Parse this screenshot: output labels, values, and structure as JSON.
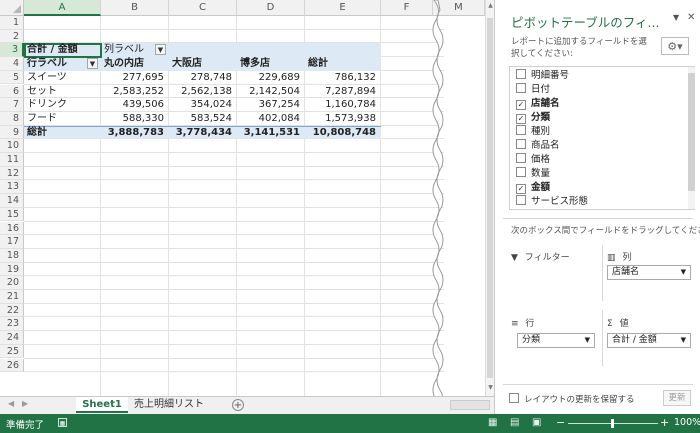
{
  "columns": [
    "A",
    "B",
    "C",
    "D",
    "E",
    "F",
    "M"
  ],
  "rows": [
    "1",
    "2",
    "3",
    "4",
    "5",
    "6",
    "7",
    "8",
    "9",
    "10",
    "11",
    "12",
    "13",
    "14",
    "15",
    "16",
    "17",
    "18",
    "19",
    "20",
    "21",
    "22",
    "23",
    "24",
    "25",
    "26"
  ],
  "pivot": {
    "corner_label": "合計 / 金額",
    "col_labels": "列ラベル",
    "row_labels": "行ラベル",
    "headers": [
      "丸の内店",
      "大阪店",
      "博多店",
      "総計"
    ],
    "rows": [
      {
        "label": "スイーツ",
        "values": [
          "277,695",
          "278,748",
          "229,689",
          "786,132"
        ]
      },
      {
        "label": "セット",
        "values": [
          "2,583,252",
          "2,562,138",
          "2,142,504",
          "7,287,894"
        ]
      },
      {
        "label": "ドリンク",
        "values": [
          "439,506",
          "354,024",
          "367,254",
          "1,160,784"
        ]
      },
      {
        "label": "フード",
        "values": [
          "588,330",
          "583,524",
          "402,084",
          "1,573,938"
        ]
      }
    ],
    "total_label": "総計",
    "total_values": [
      "3,888,783",
      "3,778,434",
      "3,141,531",
      "10,808,748"
    ]
  },
  "sheet_tabs": [
    "Sheet1",
    "売上明細リスト"
  ],
  "status_text": "準備完了",
  "zoom": "100%",
  "panel": {
    "title": "ピボットテーブルのフィ...",
    "subtitle": "レポートに追加するフィールドを選択してください:",
    "fields": [
      {
        "name": "明細番号",
        "checked": false
      },
      {
        "name": "日付",
        "checked": false
      },
      {
        "name": "店舗名",
        "checked": true
      },
      {
        "name": "分類",
        "checked": true
      },
      {
        "name": "種別",
        "checked": false
      },
      {
        "name": "商品名",
        "checked": false
      },
      {
        "name": "価格",
        "checked": false
      },
      {
        "name": "数量",
        "checked": false
      },
      {
        "name": "金額",
        "checked": true
      },
      {
        "name": "サービス形態",
        "checked": false
      }
    ],
    "drag_hint": "次のボックス間でフィールドをドラッグしてください:",
    "filter_label": "フィルター",
    "columns_label": "列",
    "columns_value": "店舗名",
    "rows_label": "行",
    "rows_value": "分類",
    "values_label": "値",
    "values_value": "合計 / 金額",
    "defer_label": "レイアウトの更新を保留する",
    "update_button": "更新"
  },
  "colors": {
    "excel_green": "#217346",
    "pivot_band": "#dde9f5"
  }
}
